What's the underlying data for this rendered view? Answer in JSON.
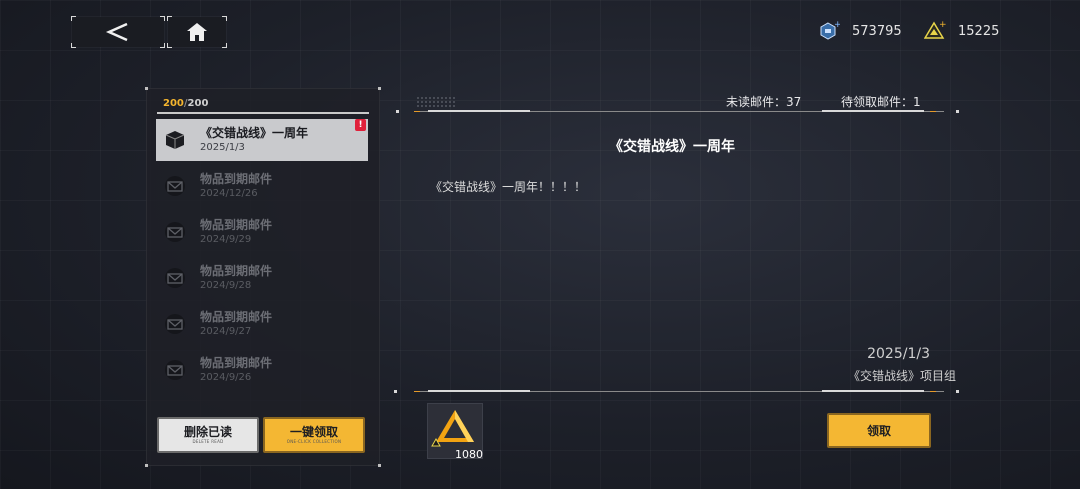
{
  "header": {
    "back_icon": "chevron-left-icon",
    "home_icon": "home-icon",
    "currencies": [
      {
        "icon": "data-chip-icon",
        "value": "573795"
      },
      {
        "icon": "triangle-gem-icon",
        "value": "15225"
      }
    ]
  },
  "mailbox": {
    "count_current": "200",
    "count_separator": "/",
    "count_max": "200",
    "items": [
      {
        "title": "《交错战线》一周年",
        "date": "2025/1/3",
        "badge": "!",
        "icon": "package-icon"
      },
      {
        "title": "物品到期邮件",
        "date": "2024/12/26",
        "icon": "envelope-icon"
      },
      {
        "title": "物品到期邮件",
        "date": "2024/9/29",
        "icon": "envelope-icon"
      },
      {
        "title": "物品到期邮件",
        "date": "2024/9/28",
        "icon": "envelope-icon"
      },
      {
        "title": "物品到期邮件",
        "date": "2024/9/27",
        "icon": "envelope-icon"
      },
      {
        "title": "物品到期邮件",
        "date": "2024/9/26",
        "icon": "envelope-icon"
      }
    ],
    "delete_label": "删除已读",
    "delete_sublabel": "DELETE READ",
    "collect_label": "一键领取",
    "collect_sublabel": "ONE-CLICK COLLECTION"
  },
  "detail": {
    "unread_label": "未读邮件：37",
    "pending_label": "待领取邮件：1",
    "title": "《交错战线》一周年",
    "body": "《交错战线》一周年！！！！",
    "date": "2025/1/3",
    "sender": "《交错战线》项目组",
    "reward": {
      "icon": "triangle-gem-icon",
      "quantity": "1080"
    },
    "claim_label": "领取"
  },
  "colors": {
    "accent": "#f4b733",
    "badge": "#e0203a",
    "selected": "#c9cacd"
  }
}
